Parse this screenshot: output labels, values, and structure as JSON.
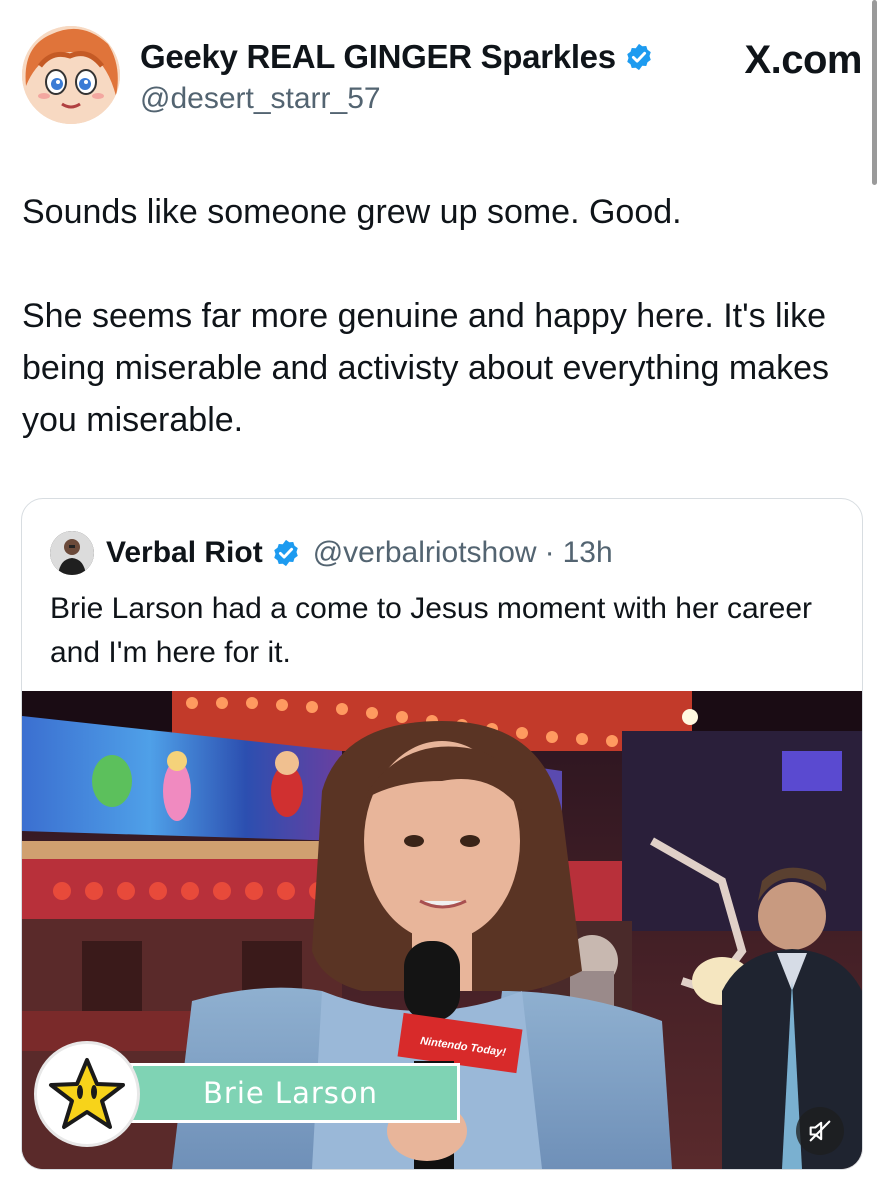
{
  "author": {
    "display_name": "Geeky REAL GINGER Sparkles",
    "handle": "@desert_starr_57",
    "verified_color": "#1d9bf0"
  },
  "watermark": "X.com",
  "tweet": {
    "paragraphs": [
      "Sounds like someone grew up some.  Good.",
      "She seems far more genuine and happy here.  It's like being miserable and activisty about everything makes you miserable."
    ]
  },
  "quoted_tweet": {
    "display_name": "Verbal Riot",
    "handle": "@verbalriotshow",
    "separator": "·",
    "time": "13h",
    "text": "Brie Larson had a come to Jesus moment with her career and I'm here for it.",
    "media": {
      "lower_third_name": "Brie Larson",
      "mic_flag_text": "Nintendo Today!",
      "badge_icon": "super-star-icon",
      "mute_icon": "volume-muted-icon"
    }
  },
  "colors": {
    "text": "#0f1419",
    "secondary": "#536471",
    "border": "#d8dde1",
    "name_plate": "#7fd3b4"
  }
}
